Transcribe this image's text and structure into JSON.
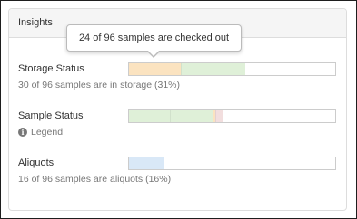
{
  "panel": {
    "title": "Insights"
  },
  "tooltip": {
    "text": "24 of 96 samples are checked out"
  },
  "rows": {
    "storage": {
      "label": "Storage Status",
      "summary": "30 of 96 samples are in storage (31%)",
      "segments": [
        {
          "name": "checked-out",
          "value": 24,
          "color": "#fbe3c0"
        },
        {
          "name": "in-storage",
          "value": 30,
          "color": "#dff0d8"
        }
      ],
      "total": 96
    },
    "sample": {
      "label": "Sample Status",
      "legend_label": "Legend",
      "segments": [
        {
          "name": "status-a",
          "value": 19,
          "color": "#dff0d8"
        },
        {
          "name": "status-b",
          "value": 20,
          "color": "#dff0d8"
        },
        {
          "name": "status-c",
          "value": 1,
          "color": "#fbe3c0"
        },
        {
          "name": "status-d",
          "value": 4,
          "color": "#f2dede"
        }
      ],
      "total": 96
    },
    "aliquots": {
      "label": "Aliquots",
      "summary": "16 of 96 samples are aliquots (16%)",
      "segments": [
        {
          "name": "aliquots",
          "value": 16,
          "color": "#d9e8f7"
        }
      ],
      "total": 96
    }
  },
  "icons": {
    "legend": "info-icon"
  }
}
